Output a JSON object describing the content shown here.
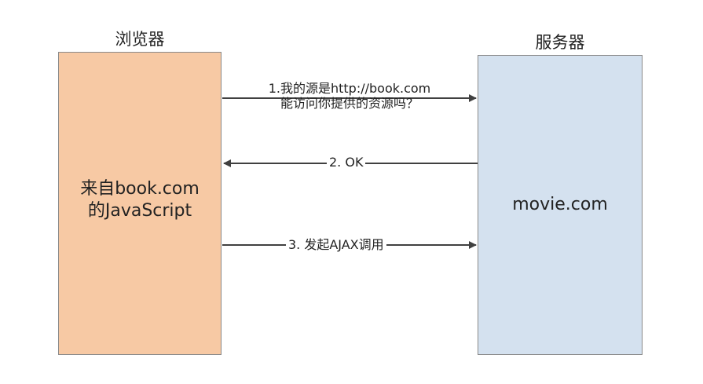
{
  "actors": {
    "browser": {
      "title": "浏览器",
      "content_line1": "来自book.com",
      "content_line2": "的JavaScript"
    },
    "server": {
      "title": "服务器",
      "content": "movie.com"
    }
  },
  "messages": {
    "m1_line1": "1.我的源是http://book.com",
    "m1_line2": "能访问你提供的资源吗？",
    "m2": "2. OK",
    "m3": "3. 发起AJAX调用"
  },
  "colors": {
    "browser_fill": "#f7c9a4",
    "server_fill": "#d4e1ef",
    "arrow": "#404040"
  }
}
